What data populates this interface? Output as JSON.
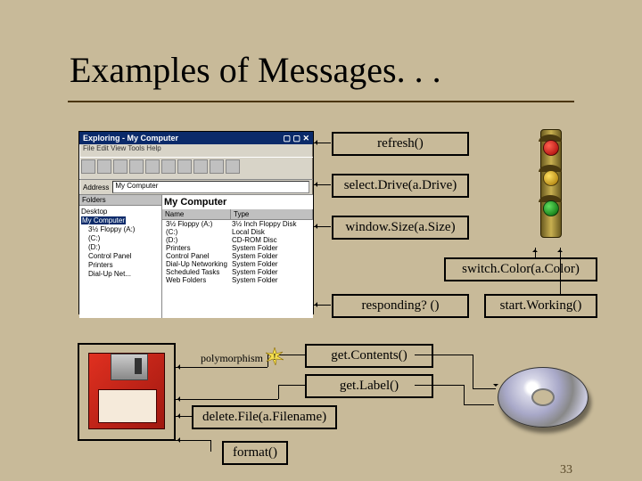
{
  "title": "Examples of Messages. . .",
  "slide_number": "33",
  "messages": {
    "refresh": "refresh()",
    "select_drive": "select.Drive(a.Drive)",
    "window_size": "window.Size(a.Size)",
    "responding": "responding? ()",
    "switch_color": "switch.Color(a.Color)",
    "start_working": "start.Working()",
    "get_contents": "get.Contents()",
    "get_label": "get.Label()",
    "delete_file": "delete.File(a.Filename)",
    "format": "format()"
  },
  "polymorphism_label": "polymorphism",
  "explorer": {
    "title": "Exploring - My Computer",
    "menu": "File  Edit  View  Tools  Help",
    "address_label": "Address",
    "address_value": "My Computer",
    "tree_header": "Folders",
    "tree_items": [
      "Desktop",
      "My Computer",
      "3½ Floppy (A:)",
      "(C:)",
      "(D:)",
      "Control Panel",
      "Printers",
      "Dial-Up Net..."
    ],
    "main_header": "My Computer",
    "columns": [
      "Name",
      "Type"
    ],
    "rows": [
      [
        "3½ Floppy (A:)",
        "3½ Inch Floppy Disk"
      ],
      [
        "(C:)",
        "Local Disk"
      ],
      [
        "(D:)",
        "CD-ROM Disc"
      ],
      [
        "Printers",
        "System Folder"
      ],
      [
        "Control Panel",
        "System Folder"
      ],
      [
        "Dial-Up Networking",
        "System Folder"
      ],
      [
        "Scheduled Tasks",
        "System Folder"
      ],
      [
        "Web Folders",
        "System Folder"
      ]
    ]
  }
}
